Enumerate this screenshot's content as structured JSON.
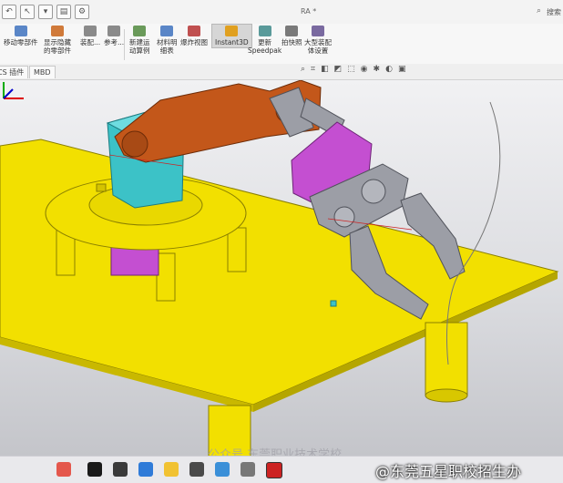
{
  "window": {
    "title": "RA *",
    "search_label": "搜索"
  },
  "ribbon": {
    "items": [
      {
        "label1": "移动零部件",
        "label2": "",
        "icon": "move-component-icon",
        "color": "#5a86c7"
      },
      {
        "label1": "显示隐藏",
        "label2": "的零部件",
        "icon": "show-hidden-icon",
        "color": "#d07a3a"
      },
      {
        "label1": "装配...",
        "label2": "",
        "icon": "assembly-feature-icon",
        "color": "#8a8a8a"
      },
      {
        "label1": "参考...",
        "label2": "",
        "icon": "reference-geometry-icon",
        "color": "#8a8a8a"
      },
      {
        "label1": "新建运",
        "label2": "动算例",
        "icon": "new-motion-study-icon",
        "color": "#6a9a5a"
      },
      {
        "label1": "材料明",
        "label2": "细表",
        "icon": "bom-icon",
        "color": "#5a86c7"
      },
      {
        "label1": "爆炸视图",
        "label2": "",
        "icon": "exploded-view-icon",
        "color": "#c05050"
      },
      {
        "label1": "Instant3D",
        "label2": "",
        "icon": "instant3d-icon",
        "color": "#e0a020"
      },
      {
        "label1": "更新",
        "label2": "Speedpak",
        "icon": "speedpak-icon",
        "color": "#5a9a9a"
      },
      {
        "label1": "拍快照",
        "label2": "",
        "icon": "snapshot-icon",
        "color": "#7a7a7a"
      },
      {
        "label1": "大型装配",
        "label2": "体设置",
        "icon": "large-assembly-icon",
        "color": "#7a6aa0"
      }
    ]
  },
  "tabs": [
    {
      "label": "CS 插件"
    },
    {
      "label": "MBD"
    }
  ],
  "overlay": {
    "watermark": "@东莞五星职校招生办",
    "faint_text": "公众号 东莞职业技术学校"
  },
  "colors": {
    "table": "#f2e000",
    "arm_orange": "#c3571a",
    "base_cyan": "#3cc2c7",
    "gripper_magenta": "#c44fd1",
    "gripper_grey": "#9c9ea6"
  }
}
